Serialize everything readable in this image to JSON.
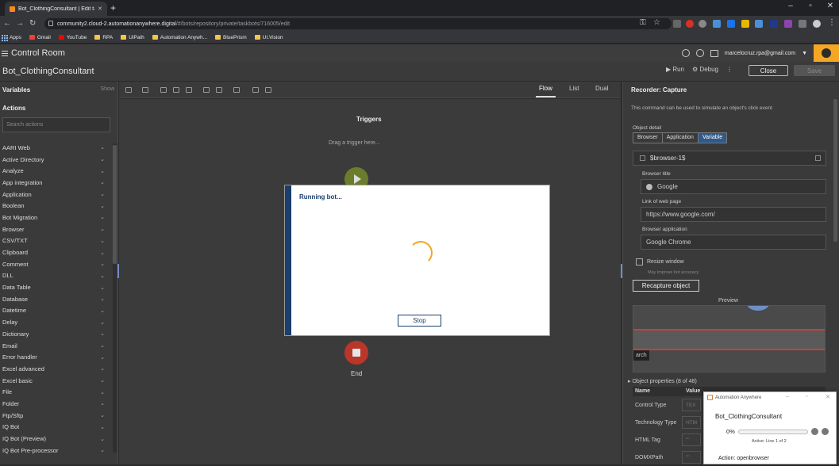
{
  "browser": {
    "tab_title": "Bot_ClothingConsultant | Edit ta",
    "url_host": "community2.cloud-2.automationanywhere.digital",
    "url_path": "/#/bots/repository/private/taskbots/716005/edit",
    "bookmarks": [
      "Apps",
      "Gmail",
      "YouTube",
      "RPA",
      "UiPath",
      "Automation Anywh...",
      "BluePrism",
      "UI.Vision"
    ]
  },
  "header": {
    "title": "Control Room",
    "user_email": "marcelocruz.rpa@gmail.com"
  },
  "botbar": {
    "bot_name": "Bot_ClothingConsultant",
    "run_label": "Run",
    "debug_label": "Debug",
    "close_label": "Close",
    "save_label": "Save"
  },
  "left_panel": {
    "variables_label": "Variables",
    "show_label": "Show",
    "actions_label": "Actions",
    "search_placeholder": "Search actions",
    "actions": [
      "AARI Web",
      "Active Directory",
      "Analyze",
      "App integration",
      "Application",
      "Boolean",
      "Bot Migration",
      "Browser",
      "CSV/TXT",
      "Clipboard",
      "Comment",
      "DLL",
      "Data Table",
      "Database",
      "Datetime",
      "Delay",
      "Dictionary",
      "Email",
      "Error handler",
      "Excel advanced",
      "Excel basic",
      "File",
      "Folder",
      "Ftp/Sftp",
      "IQ Bot",
      "IQ Bot (Preview)",
      "IQ Bot Pre-processor"
    ]
  },
  "view_tabs": [
    "Flow",
    "List",
    "Dual"
  ],
  "canvas": {
    "triggers_label": "Triggers",
    "drag_trigger_hint": "Drag a trigger here...",
    "end_label": "End"
  },
  "modal": {
    "title": "Running bot...",
    "stop_label": "Stop"
  },
  "right_panel": {
    "title": "Recorder: Capture",
    "description": "This command can be used to simulate an object's click event",
    "object_detail_label": "Object detail",
    "segments": [
      "Browser",
      "Application",
      "Variable"
    ],
    "selected_segment": "Variable",
    "variable_value": "$browser-1$",
    "browser_title_label": "Browser title",
    "browser_title_value": "Google",
    "link_label": "Link of web page",
    "link_value": "https://www.google.com/",
    "browser_app_label": "Browser application",
    "browser_app_value": "Google Chrome",
    "resize_label": "Resize window",
    "improve_label": "May improve bot accuracy",
    "recapture_label": "Recapture object",
    "preview_label": "Preview",
    "preview_snippet": "arch",
    "object_props_label": "Object properties (8 of 48)",
    "prop_header_name": "Name",
    "prop_header_value": "Value",
    "props": [
      {
        "name": "Control Type",
        "value": "TEX"
      },
      {
        "name": "Technology Type",
        "value": "HTM"
      },
      {
        "name": "HTML Tag",
        "value": "\"\""
      },
      {
        "name": "DOMXPath",
        "value": "\"\""
      }
    ]
  },
  "aa_window": {
    "title": "Automation Anywhere",
    "bot_name": "Bot_ClothingConsultant",
    "percent_text": "0%",
    "progress": 0,
    "line_text": "Active: Line 1 of 2",
    "action_text": "Action: openbrowser"
  },
  "colors": {
    "brand_orange": "#f5a623",
    "navy": "#1b3e6a",
    "start_green": "#6b7d2a",
    "end_red": "#b8372a"
  }
}
